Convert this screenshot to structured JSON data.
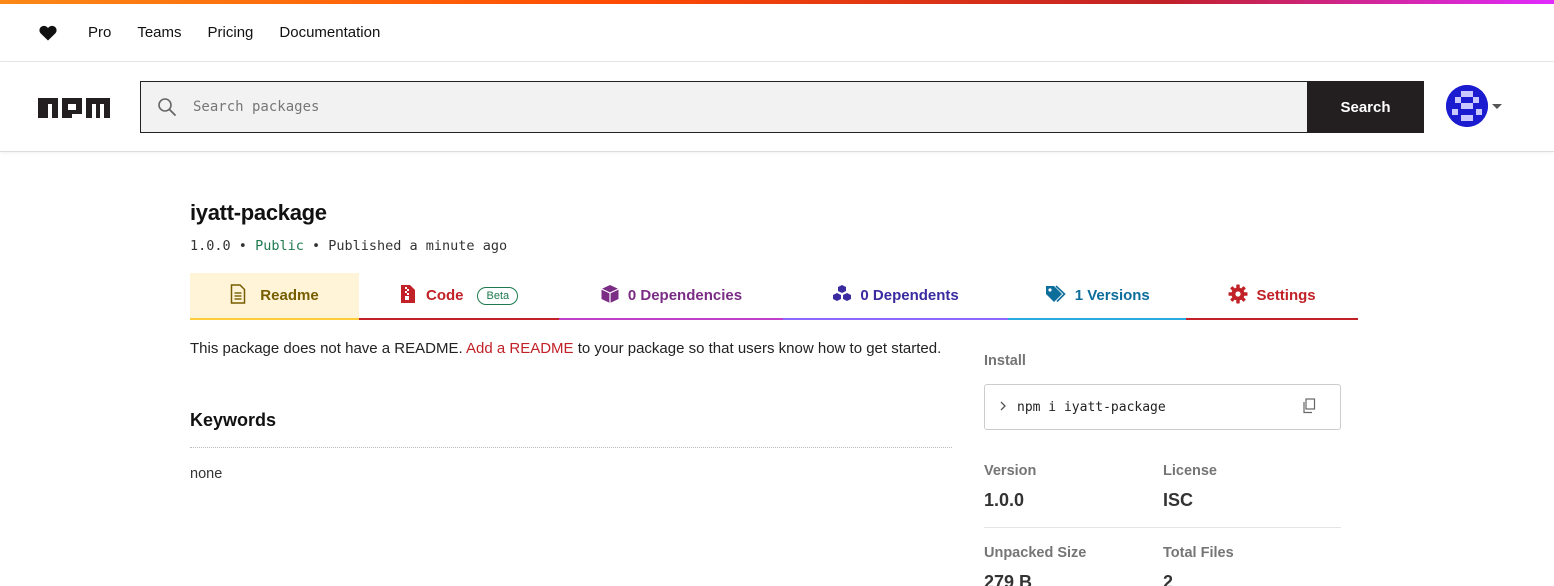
{
  "nav": {
    "heart_icon": "heart-icon",
    "links": [
      "Pro",
      "Teams",
      "Pricing",
      "Documentation"
    ]
  },
  "header": {
    "logo_text": "npm",
    "search_placeholder": "Search packages",
    "search_button": "Search"
  },
  "package": {
    "name": "iyatt-package",
    "version": "1.0.0",
    "separator": "•",
    "visibility": "Public",
    "published": "Published a minute ago"
  },
  "tabs": [
    {
      "label": "Readme",
      "icon": "readme-icon"
    },
    {
      "label": "Code",
      "icon": "code-file-icon",
      "badge": "Beta"
    },
    {
      "label": "0 Dependencies",
      "icon": "box-icon"
    },
    {
      "label": "0 Dependents",
      "icon": "boxes-icon"
    },
    {
      "label": "1 Versions",
      "icon": "tags-icon"
    },
    {
      "label": "Settings",
      "icon": "gear-icon"
    }
  ],
  "readme": {
    "message_before": "This package does not have a README.",
    "link": "Add a README",
    "message_after": "to your package so that users know how to get started."
  },
  "keywords": {
    "heading": "Keywords",
    "value": "none"
  },
  "sidebar": {
    "install_label": "Install",
    "install_command": "npm i iyatt-package",
    "version_label": "Version",
    "version_value": "1.0.0",
    "license_label": "License",
    "license_value": "ISC",
    "unpacked_label": "Unpacked Size",
    "unpacked_value": "279 B",
    "files_label": "Total Files",
    "files_value": "2"
  },
  "colors": {
    "readme": "#765d00",
    "code": "#c12127",
    "dependencies": "#7b2c84",
    "dependents": "#3a2ba0",
    "versions": "#0d6d9b",
    "settings": "#c12127",
    "public": "#1d7a4f"
  }
}
